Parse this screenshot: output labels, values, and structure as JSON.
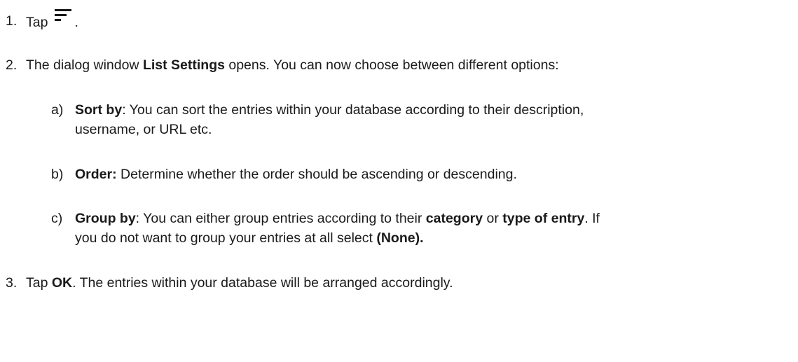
{
  "steps": [
    {
      "number": "1.",
      "text_before": "Tap",
      "icon": "sort-list-icon",
      "text_after": "."
    },
    {
      "number": "2.",
      "text_before": "The dialog window ",
      "bold": "List Settings",
      "text_after": " opens. You can now choose between different options:"
    },
    {
      "number": "3.",
      "text_before": "Tap ",
      "bold": "OK",
      "text_after": ". The entries within your database will be arranged accordingly."
    }
  ],
  "options": [
    {
      "letter": "a)",
      "bold": "Sort by",
      "line1": ": You can sort the entries within your database according to their description,",
      "line2": "username, or URL etc."
    },
    {
      "letter": "b)",
      "bold": "Order:",
      "line1": " Determine whether the order should be ascending or descending."
    },
    {
      "letter": "c)",
      "bold": "Group by",
      "line1_a": ": You can either group entries according to their ",
      "bold2": "category",
      "line1_b": " or ",
      "bold3": "type of entry",
      "line1_c": ". If",
      "line2_a": "you do not want to group your entries at all select ",
      "bold4": "(None)."
    }
  ]
}
